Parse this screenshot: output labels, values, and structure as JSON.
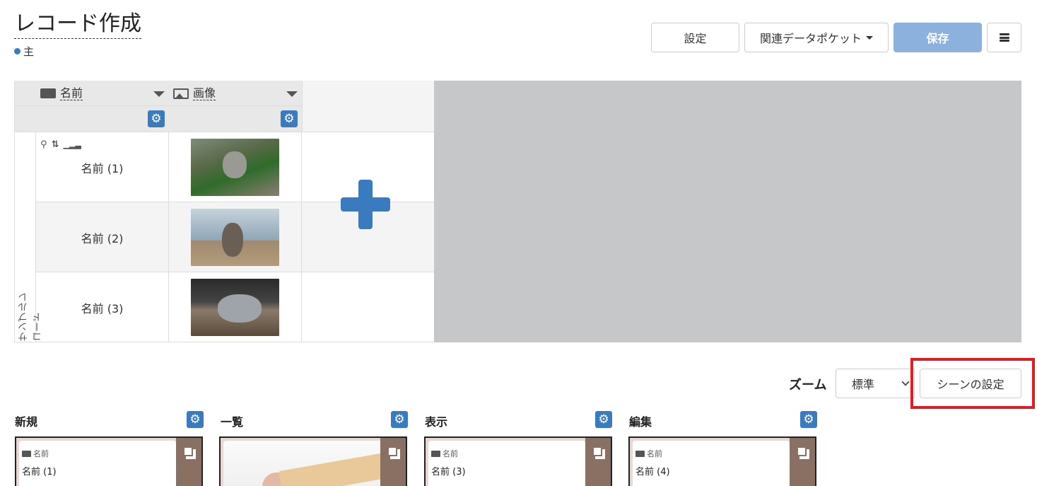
{
  "header": {
    "title": "レコード作成",
    "subtitle": "主"
  },
  "toolbar": {
    "settings_label": "設定",
    "pocket_label": "関連データポケット",
    "save_label": "保存"
  },
  "grid": {
    "columns": [
      {
        "label": "名前",
        "icon": "text-field-icon"
      },
      {
        "label": "画像",
        "icon": "image-field-icon"
      }
    ],
    "side_label": "サンプルレコード",
    "rows": [
      {
        "name": "名前 (1)",
        "image": "cat-photo-1"
      },
      {
        "name": "名前 (2)",
        "image": "cat-photo-2"
      },
      {
        "name": "名前 (3)",
        "image": "cat-photo-3"
      }
    ]
  },
  "zoom": {
    "label": "ズーム",
    "value": "標準"
  },
  "scene_settings_label": "シーンの設定",
  "scenes": [
    {
      "title": "新規",
      "field_label": "名前",
      "value": "名前 (1)"
    },
    {
      "title": "一覧",
      "field_label": "",
      "value": ""
    },
    {
      "title": "表示",
      "field_label": "名前",
      "value": "名前 (3)"
    },
    {
      "title": "編集",
      "field_label": "名前",
      "value": "名前 (4)"
    }
  ],
  "colors": {
    "accent": "#3a7bbf",
    "save_button": "#8db1dd",
    "highlight": "#e8191f",
    "empty_area": "#c6c7c9"
  }
}
